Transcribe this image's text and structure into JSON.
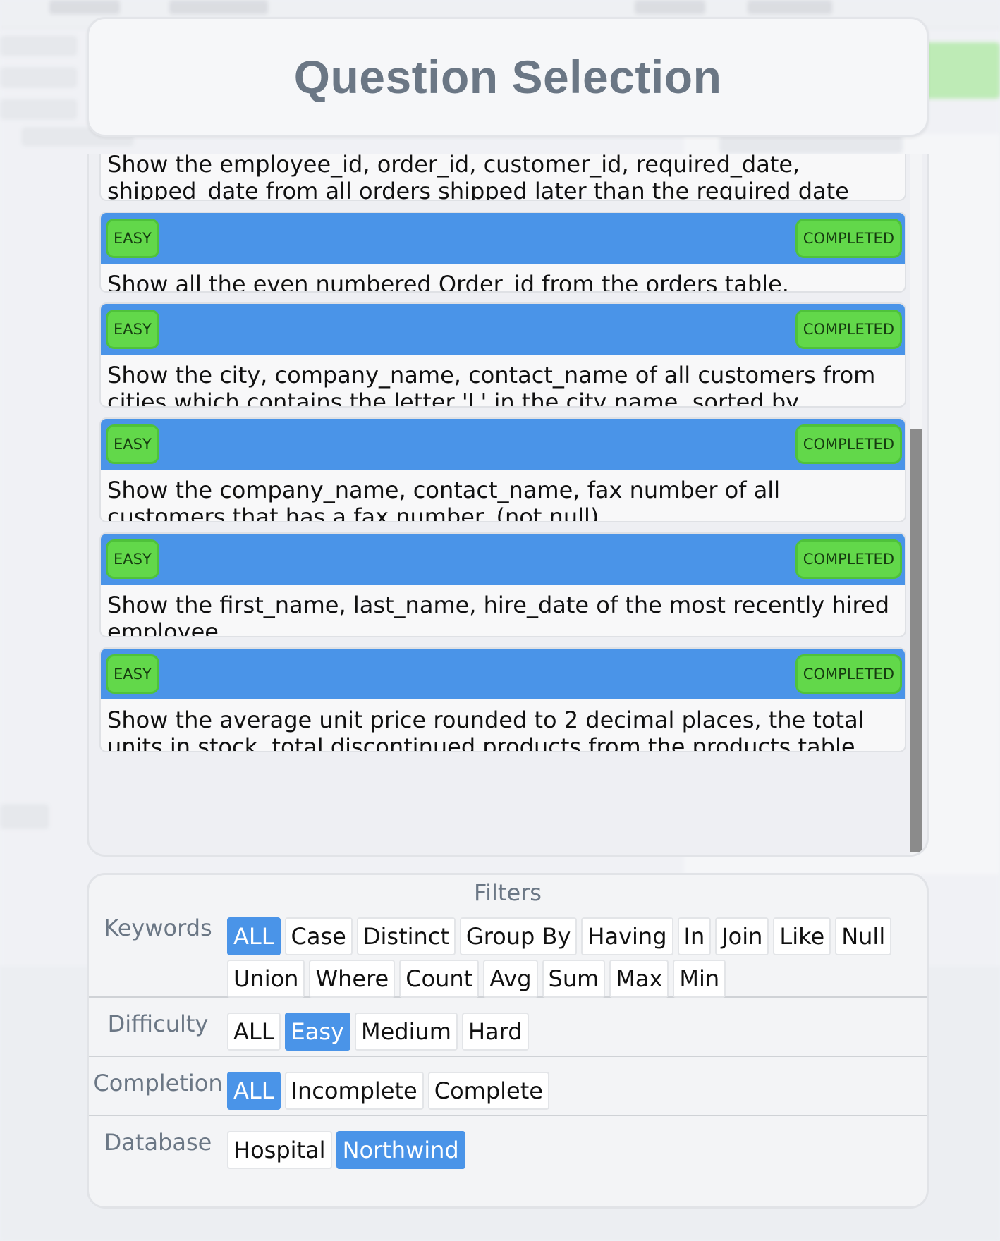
{
  "header": {
    "title": "Question Selection"
  },
  "questions": [
    {
      "difficulty": "",
      "status": "",
      "text": "Show the employee_id, order_id, customer_id, required_date, shipped_date from all orders shipped later than the required date"
    },
    {
      "difficulty": "EASY",
      "status": "COMPLETED",
      "text": "Show all the even numbered Order_id from the orders table."
    },
    {
      "difficulty": "EASY",
      "status": "COMPLETED",
      "text": "Show the city, company_name, contact_name of all customers from cities which contains the letter 'L' in the city name, sorted by contact_name"
    },
    {
      "difficulty": "EASY",
      "status": "COMPLETED",
      "text": "Show the company_name, contact_name, fax number of all customers that has a fax number. (not null)"
    },
    {
      "difficulty": "EASY",
      "status": "COMPLETED",
      "text": "Show the first_name, last_name, hire_date of the most recently hired employee."
    },
    {
      "difficulty": "EASY",
      "status": "COMPLETED",
      "text": "Show the average unit price rounded to 2 decimal places, the total units in stock, total discontinued products from the products table."
    }
  ],
  "filters": {
    "title": "Filters",
    "keywords": {
      "label": "Keywords",
      "options": [
        "ALL",
        "Case",
        "Distinct",
        "Group By",
        "Having",
        "In",
        "Join",
        "Like",
        "Null",
        "Union",
        "Where",
        "Count",
        "Avg",
        "Sum",
        "Max",
        "Min"
      ],
      "selected": "ALL"
    },
    "difficulty": {
      "label": "Difficulty",
      "options": [
        "ALL",
        "Easy",
        "Medium",
        "Hard"
      ],
      "selected": "Easy"
    },
    "completion": {
      "label": "Completion",
      "options": [
        "ALL",
        "Incomplete",
        "Complete"
      ],
      "selected": "ALL"
    },
    "database": {
      "label": "Database",
      "options": [
        "Hospital",
        "Northwind"
      ],
      "selected": "Northwind"
    }
  },
  "colors": {
    "accent_blue": "#4a94e8",
    "badge_green": "#62d84a",
    "label_gray": "#6b7785"
  }
}
